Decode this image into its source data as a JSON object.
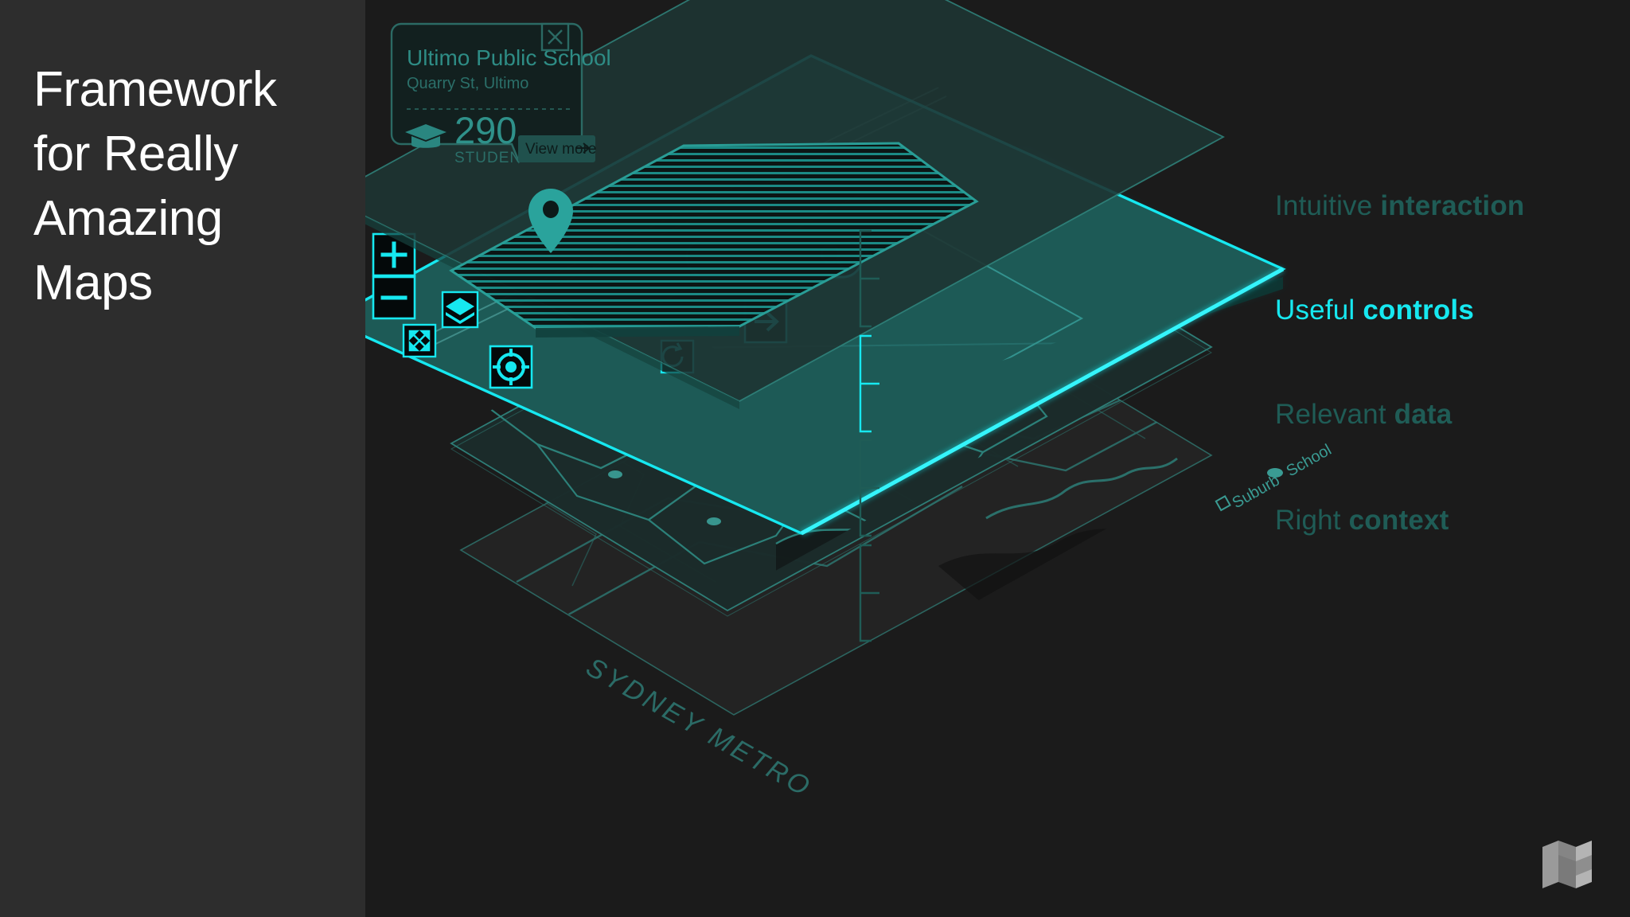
{
  "background": {
    "left_panel_color": "#2d2d2d",
    "right_panel_color": "#1b1b1b",
    "accent_bright": "#16e8f0",
    "accent_dim": "#1f5c56",
    "layer_fill": "#1d5a56"
  },
  "title": {
    "text": "Framework\nfor Really\nAmazing\nMaps"
  },
  "info_card": {
    "name": "Ultimo Public School",
    "address": "Quarry St, Ultimo",
    "stat_value": "290",
    "stat_label": "STUDENTS",
    "stat_icon": "graduation-cap-icon",
    "button_label": "View more",
    "button_icon": "arrow-right-icon",
    "close_icon": "close-icon"
  },
  "search": {
    "value": "",
    "placeholder": "",
    "icon": "search-icon"
  },
  "map_controls": [
    {
      "name": "zoom-in",
      "glyph": "+"
    },
    {
      "name": "zoom-out",
      "glyph": "−"
    },
    {
      "name": "layers",
      "glyph": "layers-icon"
    },
    {
      "name": "fullscreen",
      "glyph": "fullscreen-icon"
    },
    {
      "name": "locate",
      "glyph": "locate-icon"
    },
    {
      "name": "refresh",
      "glyph": "refresh-icon"
    },
    {
      "name": "next",
      "glyph": "arrow-right-icon"
    }
  ],
  "map_annotations": {
    "suburb_label": "Suburb",
    "school_label": "School",
    "basemap_label": "SYDNEY METRO"
  },
  "layers": [
    {
      "id": "interaction",
      "label_plain": "Intuitive ",
      "label_bold": "interaction",
      "state": "dim"
    },
    {
      "id": "controls",
      "label_plain": "Useful ",
      "label_bold": "controls",
      "state": "highlight"
    },
    {
      "id": "data",
      "label_plain": "Relevant ",
      "label_bold": "data",
      "state": "dim"
    },
    {
      "id": "context",
      "label_plain": "Right ",
      "label_bold": "context",
      "state": "dim"
    }
  ],
  "logo": {
    "name": "brand-logo"
  }
}
